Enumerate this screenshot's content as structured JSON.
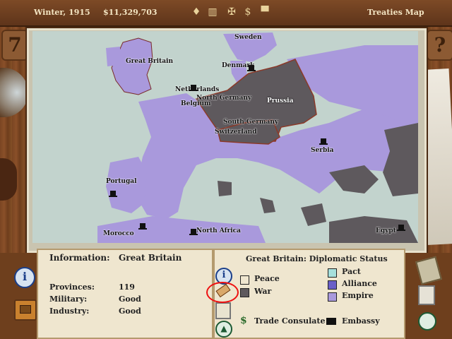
{
  "topbar": {
    "date": "Winter, 1915",
    "treasury": "$11,329,703",
    "title": "Treaties Map",
    "icons": [
      "bell-icon",
      "bank-icon",
      "gear-icon",
      "dollar-icon",
      "top-hat-icon"
    ]
  },
  "map": {
    "labels": [
      {
        "text": "Sweden"
      },
      {
        "text": "Great Britain"
      },
      {
        "text": "Denmark"
      },
      {
        "text": "Netherlands"
      },
      {
        "text": "North Germany"
      },
      {
        "text": "Belgium"
      },
      {
        "text": "Prussia"
      },
      {
        "text": "South Germany"
      },
      {
        "text": "Switzerland"
      },
      {
        "text": "Serbia"
      },
      {
        "text": "Portugal"
      },
      {
        "text": "Morocco"
      },
      {
        "text": "North Africa"
      },
      {
        "text": "Egypt"
      }
    ],
    "colors": {
      "sea": "#c2d3cd",
      "empire": "#a999dc",
      "war": "#5e595d",
      "border": "#8b3a2a"
    }
  },
  "info": {
    "title_prefix": "Information:",
    "country": "Great Britain",
    "stats": [
      {
        "label": "Provinces:",
        "value": "119"
      },
      {
        "label": "Military:",
        "value": "Good"
      },
      {
        "label": "Industry:",
        "value": "Good"
      }
    ]
  },
  "diplomacy": {
    "title": "Great Britain: Diplomatic Status",
    "legend_left": [
      {
        "label": "Peace",
        "color": "#efe6cf"
      },
      {
        "label": "War",
        "color": "#5e595d"
      }
    ],
    "legend_right": [
      {
        "label": "Pact",
        "color": "#a6e0dc"
      },
      {
        "label": "Alliance",
        "color": "#6a5fc8"
      },
      {
        "label": "Empire",
        "color": "#a999dc"
      }
    ],
    "trade": "Trade Consulate",
    "embassy": "Embassy"
  },
  "side": {
    "left_number": "7",
    "right_number": "?"
  }
}
